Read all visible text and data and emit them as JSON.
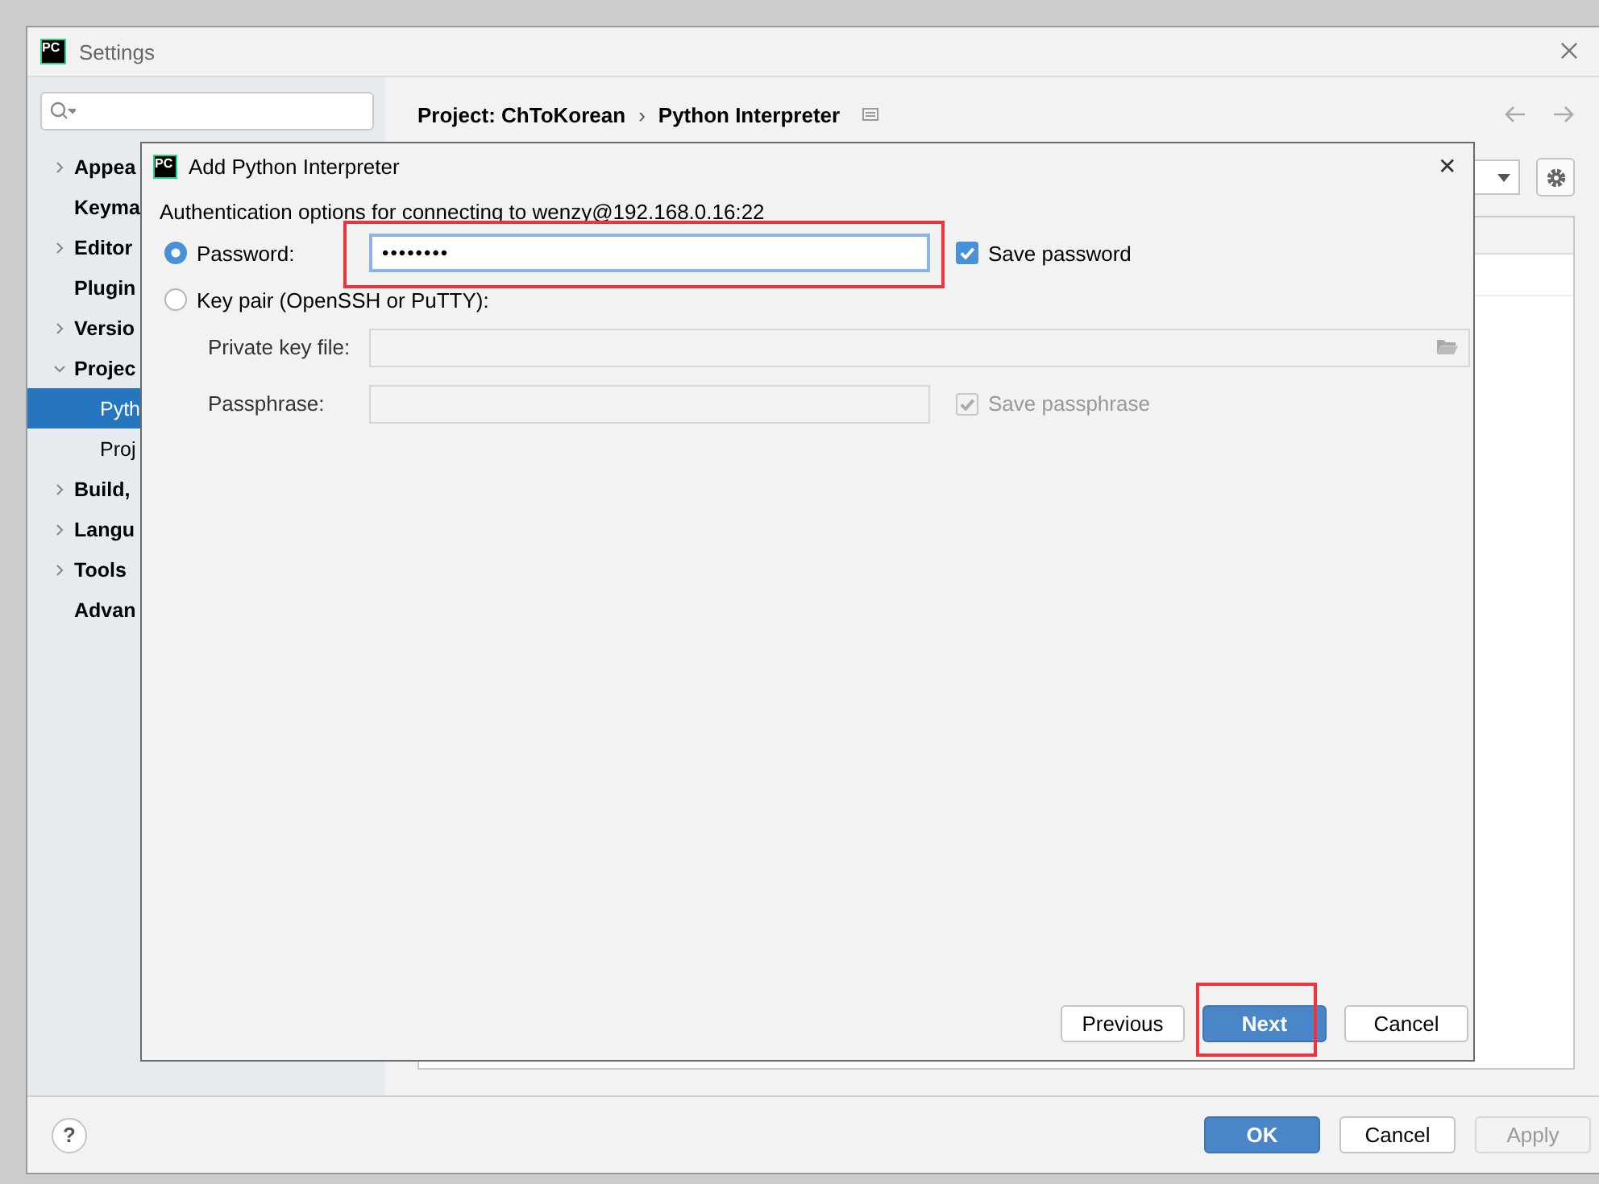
{
  "settings_window": {
    "logo_text": "PC",
    "title": "Settings"
  },
  "sidebar": {
    "items": [
      {
        "label": "Appea",
        "expanded": false,
        "selected": false
      },
      {
        "label": "Keyma",
        "selected": false
      },
      {
        "label": "Editor",
        "expanded": false,
        "selected": false
      },
      {
        "label": "Plugin",
        "selected": false
      },
      {
        "label": "Versio",
        "expanded": false,
        "selected": false
      },
      {
        "label": "Projec",
        "expanded": true,
        "selected": false,
        "children": [
          {
            "label": "Pyth",
            "selected": true
          },
          {
            "label": "Proj",
            "selected": false
          }
        ]
      },
      {
        "label": "Build,",
        "expanded": false,
        "selected": false
      },
      {
        "label": "Langu",
        "expanded": false,
        "selected": false
      },
      {
        "label": "Tools",
        "expanded": false,
        "selected": false
      },
      {
        "label": "Advan",
        "selected": false
      }
    ]
  },
  "breadcrumb": {
    "items": [
      "Project: ChToKorean",
      "Python Interpreter"
    ],
    "separator": "›"
  },
  "footer": {
    "help": "?",
    "buttons": [
      {
        "label": "OK",
        "primary": true,
        "disabled": false
      },
      {
        "label": "Cancel",
        "primary": false,
        "disabled": false
      },
      {
        "label": "Apply",
        "primary": false,
        "disabled": true
      }
    ]
  },
  "dialog": {
    "logo_text": "PC",
    "title": "Add Python Interpreter",
    "close": "✕",
    "description": "Authentication options for connecting to wenzy@192.168.0.16:22",
    "password_option": {
      "label": "Password:",
      "selected": true,
      "value": "••••••••",
      "highlighted": true,
      "save": {
        "label": "Save password",
        "checked": true,
        "disabled": false
      }
    },
    "keypair_option": {
      "label": "Key pair (OpenSSH or PuTTY):",
      "selected": false,
      "private_key_label": "Private key file:",
      "passphrase_label": "Passphrase:",
      "save": {
        "label": "Save passphrase",
        "checked": true,
        "disabled": true
      }
    },
    "buttons": [
      {
        "label": "Previous",
        "primary": false,
        "highlighted": false
      },
      {
        "label": "Next",
        "primary": true,
        "highlighted": true
      },
      {
        "label": "Cancel",
        "primary": false,
        "highlighted": false
      }
    ]
  }
}
